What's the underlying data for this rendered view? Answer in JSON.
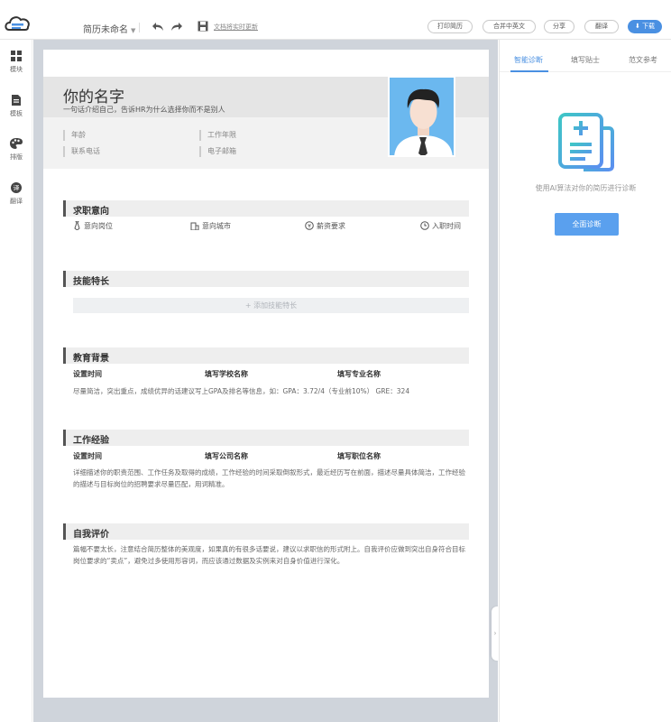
{
  "toolbar": {
    "doc_name": "简历未命名",
    "save_hint": "文档将实时更新",
    "buttons": [
      "打印简历",
      "合并中英文",
      "分享",
      "翻译",
      "下载"
    ]
  },
  "sidebar": {
    "items": [
      {
        "label": "模块",
        "icon": "modules-icon"
      },
      {
        "label": "模板",
        "icon": "template-icon"
      },
      {
        "label": "排版",
        "icon": "palette-icon"
      },
      {
        "label": "翻译",
        "icon": "translate-icon"
      }
    ]
  },
  "resume": {
    "name": "你的名字",
    "tagline": "一句话介绍自己，告诉HR为什么选择你而不是别人",
    "info": {
      "age": "年龄",
      "years": "工作年限",
      "phone": "联系电话",
      "email": "电子邮箱"
    },
    "sections": {
      "intent": {
        "title": "求职意向",
        "items": [
          "意向岗位",
          "意向城市",
          "薪资要求",
          "入职时间"
        ]
      },
      "skills": {
        "title": "技能特长",
        "add": "+ 添加技能特长"
      },
      "education": {
        "title": "教育背景",
        "cols": [
          "设置时间",
          "填写学校名称",
          "填写专业名称"
        ],
        "text": "尽量简洁，突出重点，成绩优异的话建议写上GPA及排名等信息，如：GPA：3.72/4（专业前10%） GRE：324"
      },
      "work": {
        "title": "工作经验",
        "cols": [
          "设置时间",
          "填写公司名称",
          "填写职位名称"
        ],
        "text": "详细描述你的职责范围、工作任务及取得的成绩，工作经验的时间采取倒叙形式，最近经历写在前面，描述尽量具体简洁，工作经验的描述与目标岗位的招聘要求尽量匹配，用词精准。"
      },
      "self": {
        "title": "自我评价",
        "text": "篇幅不要太长，注意结合简历整体的美观度，如果真的有很多话要说，建议以求职信的形式附上。自我评价应做到突出自身符合目标岗位要求的“卖点”，避免过多使用形容词，而应该通过数据及实例来对自身价值进行深化。"
      }
    }
  },
  "right_panel": {
    "tabs": [
      "智能诊断",
      "填写贴士",
      "范文参考"
    ],
    "hint": "使用AI算法对你的简历进行诊断",
    "button": "全面诊断"
  },
  "colors": {
    "accent": "#4a90e2",
    "canvas_bg": "#cfd4db",
    "header_band": "#e5e5e5"
  }
}
